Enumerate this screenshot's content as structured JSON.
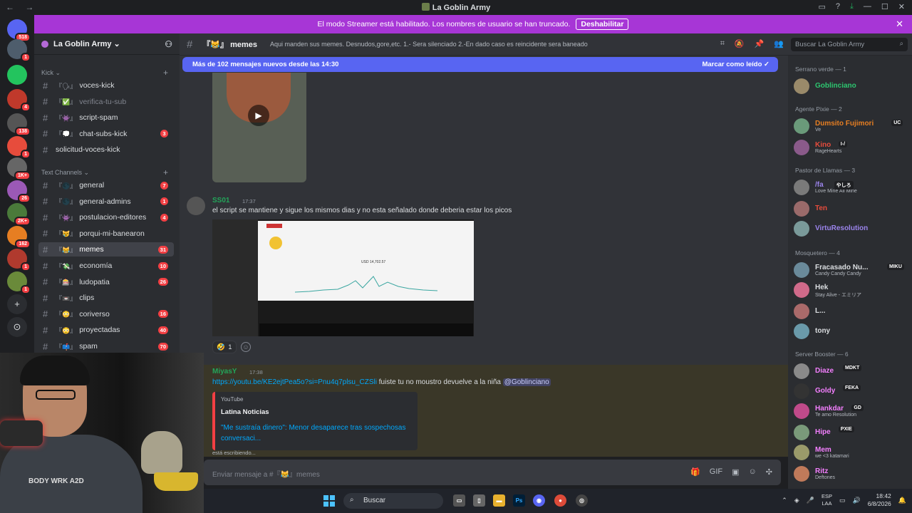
{
  "window": {
    "title": "La Goblin Army"
  },
  "banner": {
    "text": "El modo Streamer está habilitado. Los nombres de usuario se han truncado.",
    "button": "Deshabilitar"
  },
  "servers": [
    {
      "badge": "518"
    },
    {
      "badge": "1"
    },
    {
      "badge": ""
    },
    {
      "badge": "4"
    },
    {
      "badge": "138"
    },
    {
      "badge": "1"
    },
    {
      "badge": "1K+"
    },
    {
      "badge": "26"
    },
    {
      "badge": "2K+"
    },
    {
      "badge": "162"
    },
    {
      "badge": "1"
    },
    {
      "badge": "1"
    }
  ],
  "sidebar": {
    "server_name": "La Goblin Army",
    "categories": [
      {
        "name": "Kick"
      },
      {
        "name": "Text Channels"
      }
    ],
    "kick_channels": [
      {
        "name": "voces-kick",
        "icon": "『🗣』",
        "count": ""
      },
      {
        "name": "verifica-tu-sub",
        "icon": "『✅』",
        "count": ""
      },
      {
        "name": "script-spam",
        "icon": "『👾』",
        "count": ""
      },
      {
        "name": "chat-subs-kick",
        "icon": "『💭』",
        "count": "3"
      },
      {
        "name": "solicitud-voces-kick",
        "icon": "",
        "count": ""
      }
    ],
    "text_channels": [
      {
        "name": "general",
        "icon": "『🌑』",
        "count": "7"
      },
      {
        "name": "general-admins",
        "icon": "『🌑』",
        "count": "1"
      },
      {
        "name": "postulacion-editores",
        "icon": "『👾』",
        "count": "4"
      },
      {
        "name": "porqui-mi-banearon",
        "icon": "『😿』",
        "count": ""
      },
      {
        "name": "memes",
        "icon": "『😹』",
        "count": "31"
      },
      {
        "name": "economía",
        "icon": "『💸』",
        "count": "10"
      },
      {
        "name": "ludopatia",
        "icon": "『🎰』",
        "count": "26"
      },
      {
        "name": "clips",
        "icon": "『📼』",
        "count": ""
      },
      {
        "name": "coriverso",
        "icon": "『😳』",
        "count": "16"
      },
      {
        "name": "proyectadas",
        "icon": "『😳』",
        "count": "40"
      },
      {
        "name": "spam",
        "icon": "『📫』",
        "count": "70"
      }
    ]
  },
  "chat": {
    "channel_name": "memes",
    "channel_icon": "『😹』",
    "topic": "Aqui manden sus memes. Desnudos,gore,etc. 1.- Sera silenciado 2.-En dado caso es reincidente sera baneado",
    "search_placeholder": "Buscar La Goblin Army",
    "new_messages": "Más de 102 mensajes nuevos desde las 14:30",
    "mark_read": "Marcar como leído",
    "messages": [
      {
        "author": "SS01",
        "time": "17:37",
        "text": "el script se mantiene y sigue los mismos dias y no esta señalado donde deberia estar los picos",
        "reaction_count": "1",
        "screenshot_revenue": "USD 14,702.57"
      },
      {
        "author": "MiyasY",
        "time": "17:38",
        "link": "https://youtu.be/KE2ejtPea5o?si=Pnu4q7plsu_CZSli",
        "text": "fuiste tu no moustro devuelve a la niña",
        "mention": "@Goblinciano",
        "embed": {
          "provider": "YouTube",
          "author": "Latina Noticias",
          "title": "\"Me sustraía dinero\": Menor desaparece tras sospechosas conversaci..."
        }
      }
    ],
    "typing": "está escribiendo...",
    "composer_placeholder": "Enviar mensaje a #『😹』memes"
  },
  "members": {
    "groups": [
      {
        "label": "Serrano verde — 1"
      },
      {
        "label": "Agente Pixie — 2"
      },
      {
        "label": "Pastor de Llamas — 3"
      },
      {
        "label": "Mosquetero — 4"
      },
      {
        "label": "Server Booster — 6"
      }
    ],
    "list": [
      {
        "name": "Goblinciano",
        "status": "",
        "color": "#2dc770",
        "tag": ""
      },
      {
        "name": "Dumsito Fujimori",
        "status": "Ve",
        "color": "#e67e22",
        "tag": "UC"
      },
      {
        "name": "Kino",
        "status": "RageHearts",
        "color": "#e74c3c",
        "tag": "I-/"
      },
      {
        "name": "/fa",
        "status": "Love Mine All Mine",
        "color": "#9b84ec",
        "tag": "やしろ"
      },
      {
        "name": "Ten",
        "status": "",
        "color": "#e74c3c",
        "tag": ""
      },
      {
        "name": "VirtuResolution",
        "status": "",
        "color": "#9b84ec",
        "tag": ""
      },
      {
        "name": "Fracasado Nu...",
        "status": "Candy Candy Candy",
        "color": "#dbdee1",
        "tag": "MIKU"
      },
      {
        "name": "Hek",
        "status": "Stay Alive - エミリア",
        "color": "#dbdee1",
        "tag": ""
      },
      {
        "name": "L...",
        "status": "",
        "color": "#dbdee1",
        "tag": ""
      },
      {
        "name": "tony",
        "status": "",
        "color": "#dbdee1",
        "tag": ""
      },
      {
        "name": "Diaze",
        "status": "",
        "color": "#f47fff",
        "tag": "MDKT"
      },
      {
        "name": "Goldy",
        "status": "",
        "color": "#f47fff",
        "tag": "FEKA"
      },
      {
        "name": "Hankdar",
        "status": "Te amo Resolution",
        "color": "#f47fff",
        "tag": "GD"
      },
      {
        "name": "Hipe",
        "status": "",
        "color": "#f47fff",
        "tag": "PXIE"
      },
      {
        "name": "Mem",
        "status": "we <3 katamari",
        "color": "#f47fff",
        "tag": ""
      },
      {
        "name": "Ritz",
        "status": "Deftones",
        "color": "#f47fff",
        "tag": ""
      }
    ]
  },
  "webcam": {
    "shirt_text": "BODY WRK A2D"
  },
  "taskbar": {
    "search": "Buscar",
    "lang_line1": "ESP",
    "lang_line2": "LAA",
    "time": "18:42",
    "date": "6/8/2026"
  }
}
